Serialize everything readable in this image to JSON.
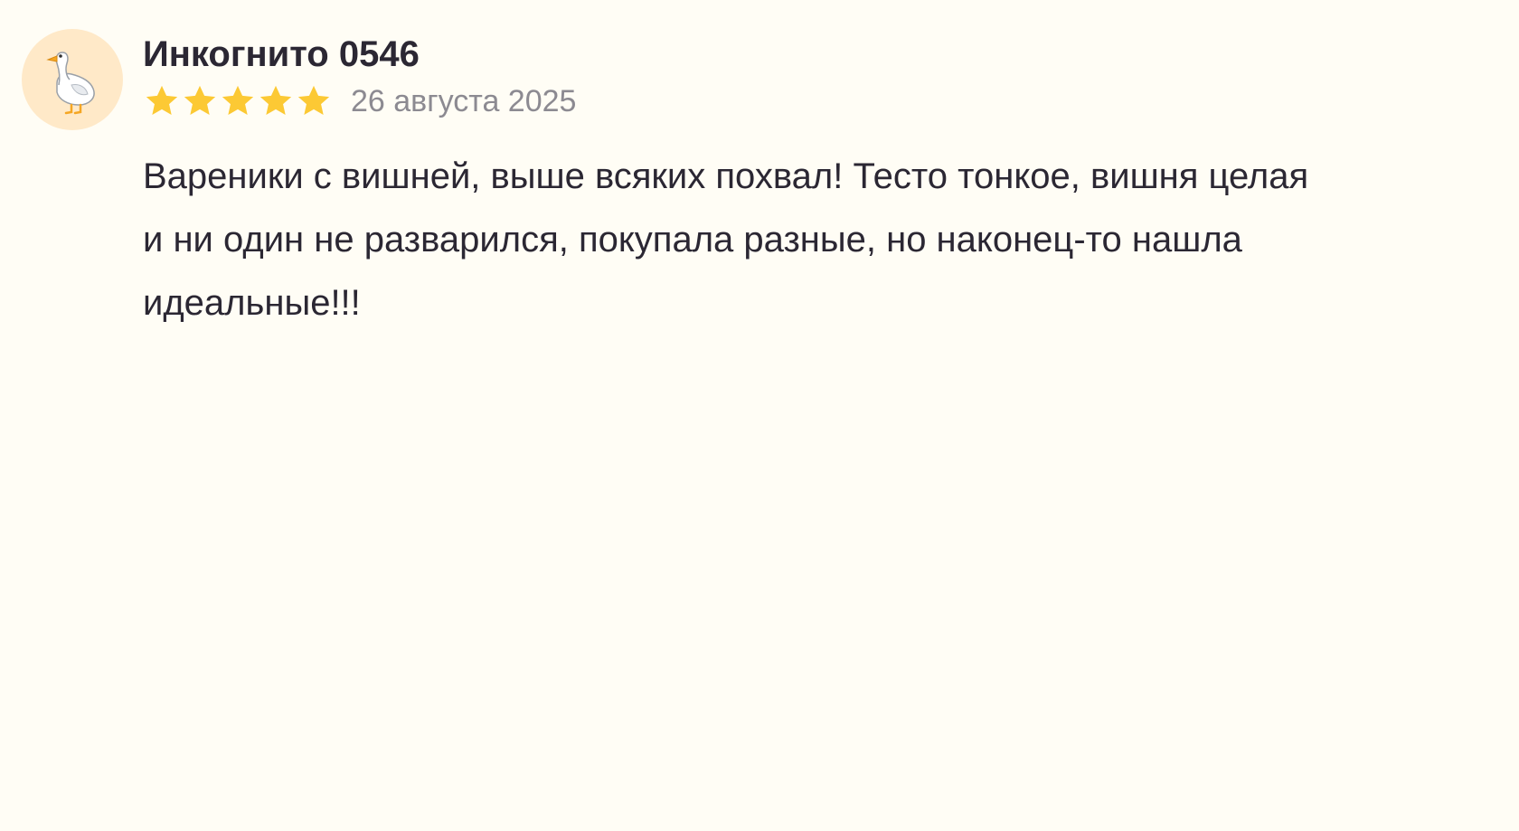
{
  "review": {
    "author": "Инкогнито 0546",
    "avatar_icon": "goose-icon",
    "avatar_bg": "#ffe9c8",
    "rating": 5,
    "rating_max": 5,
    "star_color": "#fcc934",
    "date": "26 августа 2025",
    "text": "Вареники с вишней, выше всяких похвал! Тесто тонкое, вишня целая и ни один не разварился, покупала разные, но наконец-то нашла идеальные!!!"
  }
}
